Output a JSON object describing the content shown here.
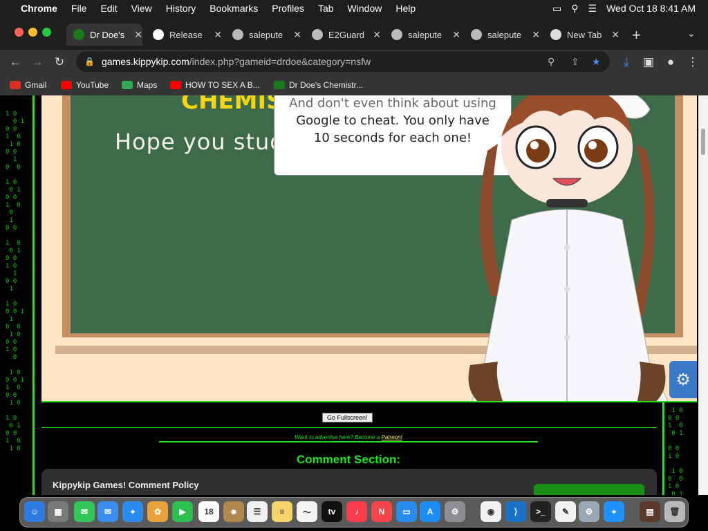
{
  "menubar": {
    "apple": "",
    "app_name": "Chrome",
    "items": [
      "File",
      "Edit",
      "View",
      "History",
      "Bookmarks",
      "Profiles",
      "Tab",
      "Window",
      "Help"
    ],
    "clock": "Wed Oct 18  8:41 AM"
  },
  "tabs": [
    {
      "label": "Dr Doe's",
      "icon": "dr-doe-favicon",
      "color": "#1b7a1b"
    },
    {
      "label": "Release",
      "icon": "github-icon",
      "color": "#ffffff"
    },
    {
      "label": "salepute",
      "icon": "globe-icon",
      "color": "#bbbbbb"
    },
    {
      "label": "E2Guard",
      "icon": "globe-icon",
      "color": "#bbbbbb"
    },
    {
      "label": "salepute",
      "icon": "globe-icon",
      "color": "#bbbbbb"
    },
    {
      "label": "salepute",
      "icon": "globe-icon",
      "color": "#bbbbbb"
    },
    {
      "label": "New Tab",
      "icon": "chrome-icon",
      "color": "#dddddd"
    }
  ],
  "address": {
    "host": "games.kippykip.com",
    "path": "/index.php?gameid=drdoe&category=nsfw"
  },
  "bookmarks": [
    {
      "label": "Gmail",
      "icon": "gmail-icon",
      "color": "#d93025"
    },
    {
      "label": "YouTube",
      "icon": "youtube-icon",
      "color": "#ff0000"
    },
    {
      "label": "Maps",
      "icon": "maps-icon",
      "color": "#34a853"
    },
    {
      "label": "HOW TO SEX A B...",
      "icon": "youtube-icon",
      "color": "#ff0000"
    },
    {
      "label": "Dr Doe's Chemistr...",
      "icon": "dr-doe-favicon",
      "color": "#1b7a1b"
    }
  ],
  "game": {
    "board_title": "CHEMIST",
    "board_text": "Hope you studied",
    "bubble_lines": [
      "And don't even think about using",
      "Google to cheat. You only have",
      "10 seconds for each one!"
    ]
  },
  "page": {
    "fullscreen_label": "Go Fullscreen!",
    "advertise_text": "Want to advertise here? Become a ",
    "patreon_link": "Patreon!",
    "comment_title": "Comment Section:",
    "policy_title": "Kippykip Games! Comment Policy"
  },
  "matrix_left": "\n\n1 0 \n  0 1\n0 0 \n1  0\n 1 0\n0 0\n  1\n0  0\n\n1 0\n 0 1\n0 0\n1  0\n 0\n 1\n0 0\n\n1  0\n 0 1\n0 0\n1 0\n  1\n0 0\n 1\n\n1 0\n0 0 1\n 1\n0  0\n 1 0\n0 0\n1 0\n  0\n\n 1 0\n0 0 1\n1  0\n0 0\n 1 0\n\n1 0\n 0 1\n0 0\n1  0\n 1 0",
  "matrix_right": "\n\n\n\n\n\n\n\n\n\n\n\n\n\n\n\n\n\n\n\n\n\n\n\n\n\n\n\n\n\n\n\n\n\n\n\n\n\n\n\n\n 1 0\n0 0\n1  0\n 0 1\n\n0 0\n1 0\n\n 1 0\n0  0\n1 0\n 0 1\n0 0",
  "dock": [
    {
      "name": "finder-icon",
      "color": "#2f7be0",
      "glyph": "☺"
    },
    {
      "name": "launchpad-icon",
      "color": "#7a7a7a",
      "glyph": "▦"
    },
    {
      "name": "messages-icon",
      "color": "#34c759",
      "glyph": "✉"
    },
    {
      "name": "mail-icon",
      "color": "#3b8ef0",
      "glyph": "✉"
    },
    {
      "name": "safari-icon",
      "color": "#2a8cf0",
      "glyph": "⌖"
    },
    {
      "name": "photos-icon",
      "color": "#e8a23a",
      "glyph": "✿"
    },
    {
      "name": "facetime-icon",
      "color": "#2bbf4b",
      "glyph": "▶"
    },
    {
      "name": "calendar-icon",
      "color": "#ffffff",
      "glyph": "18"
    },
    {
      "name": "contacts-icon",
      "color": "#b08850",
      "glyph": "☻"
    },
    {
      "name": "reminders-icon",
      "color": "#f0f0f0",
      "glyph": "☰"
    },
    {
      "name": "notes-icon",
      "color": "#f7d36b",
      "glyph": "≡"
    },
    {
      "name": "freeform-icon",
      "color": "#f5f5f5",
      "glyph": "〜"
    },
    {
      "name": "tv-icon",
      "color": "#111111",
      "glyph": "tv"
    },
    {
      "name": "music-icon",
      "color": "#fa3c4c",
      "glyph": "♪"
    },
    {
      "name": "news-icon",
      "color": "#f5454b",
      "glyph": "N"
    },
    {
      "name": "keynote-icon",
      "color": "#2b8cf0",
      "glyph": "▭"
    },
    {
      "name": "app-store-icon",
      "color": "#1c8cf5",
      "glyph": "A"
    },
    {
      "name": "system-settings-icon",
      "color": "#8e8e93",
      "glyph": "⚙"
    },
    {
      "name": "chrome-icon",
      "color": "#f1f1f1",
      "glyph": "◉"
    },
    {
      "name": "vscode-icon",
      "color": "#1a73c7",
      "glyph": "⟩"
    },
    {
      "name": "terminal-icon",
      "color": "#222222",
      "glyph": ">_"
    },
    {
      "name": "textedit-icon",
      "color": "#f2f2f2",
      "glyph": "✎"
    },
    {
      "name": "utility-icon",
      "color": "#9aa7b5",
      "glyph": "⚙"
    },
    {
      "name": "safari-blue-icon",
      "color": "#1e90ff",
      "glyph": "⌖"
    },
    {
      "name": "finder-window-icon",
      "color": "#5a3a2a",
      "glyph": "▤"
    },
    {
      "name": "trash-icon",
      "color": "#b8b8b8",
      "glyph": "🗑"
    }
  ]
}
